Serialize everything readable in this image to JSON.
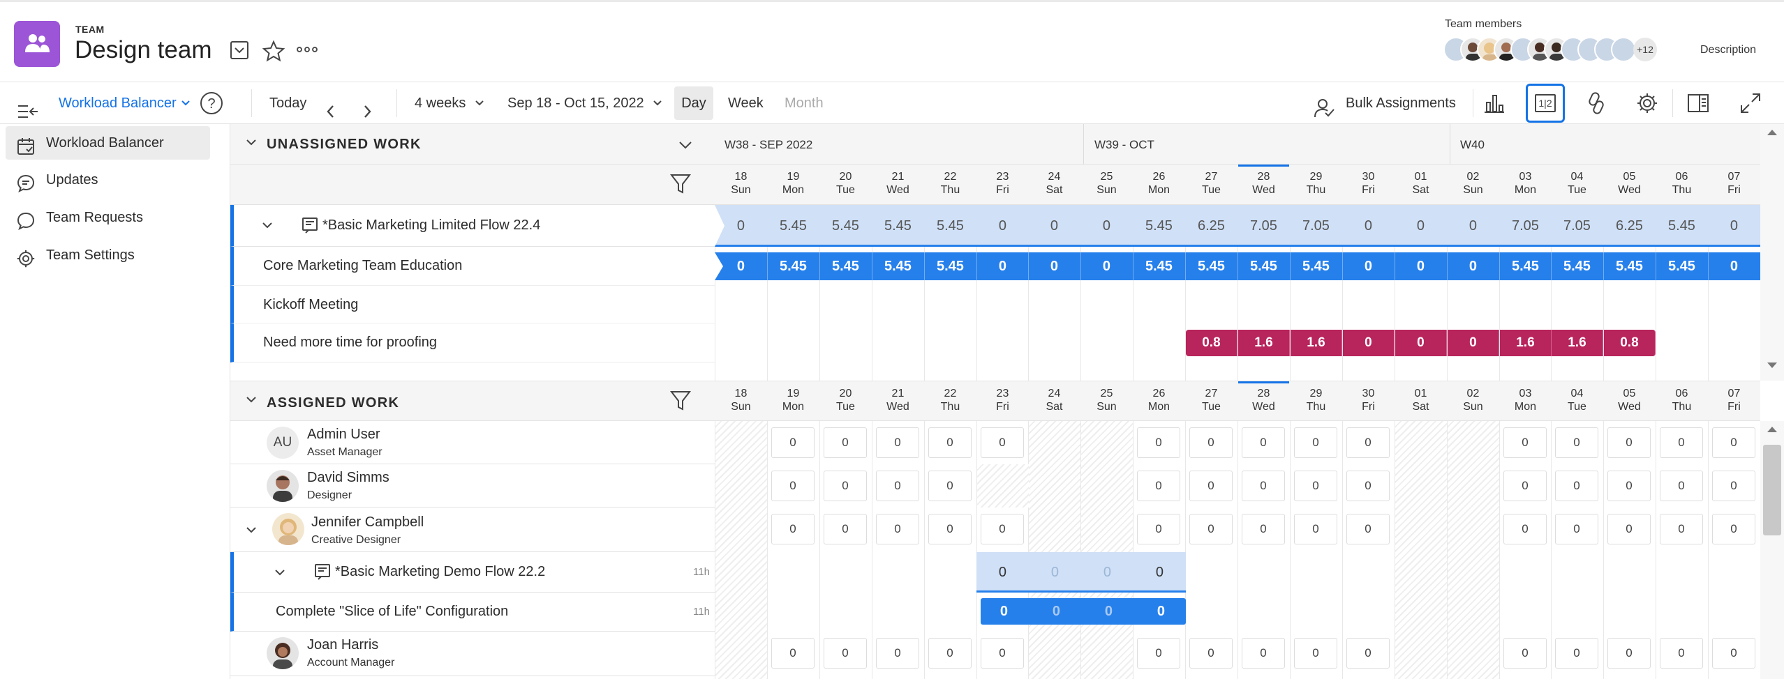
{
  "header": {
    "kicker": "TEAM",
    "title": "Design team",
    "members_label": "Team members",
    "members_more": "+12",
    "description_label": "Description"
  },
  "toolbar": {
    "view_name": "Workload Balancer",
    "today": "Today",
    "range_select": "4 weeks",
    "date_range": "Sep 18 - Oct 15, 2022",
    "day": "Day",
    "week": "Week",
    "month": "Month",
    "bulk_assignments": "Bulk Assignments",
    "toggle_label": "1|2"
  },
  "nav": [
    {
      "label": "Workload Balancer",
      "icon": "calendar-icon",
      "active": true
    },
    {
      "label": "Updates",
      "icon": "chat-bubble-icon",
      "active": false
    },
    {
      "label": "Team Requests",
      "icon": "chat-bubble-icon",
      "active": false
    },
    {
      "label": "Team Settings",
      "icon": "gear-icon",
      "active": false
    }
  ],
  "weeks": [
    {
      "label": "W38 - SEP 2022"
    },
    {
      "label": "W39 - OCT"
    },
    {
      "label": "W40"
    }
  ],
  "days": [
    {
      "d": "18",
      "w": "Sun",
      "weekend": true
    },
    {
      "d": "19",
      "w": "Mon"
    },
    {
      "d": "20",
      "w": "Tue"
    },
    {
      "d": "21",
      "w": "Wed"
    },
    {
      "d": "22",
      "w": "Thu"
    },
    {
      "d": "23",
      "w": "Fri"
    },
    {
      "d": "24",
      "w": "Sat",
      "weekend": true
    },
    {
      "d": "25",
      "w": "Sun",
      "weekend": true
    },
    {
      "d": "26",
      "w": "Mon"
    },
    {
      "d": "27",
      "w": "Tue"
    },
    {
      "d": "28",
      "w": "Wed",
      "today": true
    },
    {
      "d": "29",
      "w": "Thu"
    },
    {
      "d": "30",
      "w": "Fri"
    },
    {
      "d": "01",
      "w": "Sat",
      "weekend": true
    },
    {
      "d": "02",
      "w": "Sun",
      "weekend": true
    },
    {
      "d": "03",
      "w": "Mon"
    },
    {
      "d": "04",
      "w": "Tue"
    },
    {
      "d": "05",
      "w": "Wed"
    },
    {
      "d": "06",
      "w": "Thu"
    },
    {
      "d": "07",
      "w": "Fri"
    }
  ],
  "unassigned": {
    "title": "UNASSIGNED WORK",
    "project": {
      "name": "*Basic Marketing Limited Flow 22.4",
      "values": [
        "0",
        "5.45",
        "5.45",
        "5.45",
        "5.45",
        "0",
        "0",
        "0",
        "5.45",
        "6.25",
        "7.05",
        "7.05",
        "0",
        "0",
        "0",
        "7.05",
        "7.05",
        "6.25",
        "5.45",
        "0"
      ]
    },
    "tasks": [
      {
        "name": "Core Marketing Team Education",
        "values": [
          "0",
          "5.45",
          "5.45",
          "5.45",
          "5.45",
          "0",
          "0",
          "0",
          "5.45",
          "5.45",
          "5.45",
          "5.45",
          "0",
          "0",
          "0",
          "5.45",
          "5.45",
          "5.45",
          "5.45",
          "0"
        ]
      },
      {
        "name": "Kickoff Meeting"
      },
      {
        "name": "Need more time for proofing",
        "values": [
          "0.8",
          "1.6",
          "1.6",
          "0",
          "0",
          "0",
          "1.6",
          "1.6",
          "0.8"
        ]
      }
    ]
  },
  "assigned": {
    "title": "ASSIGNED WORK",
    "people": [
      {
        "name": "Admin User",
        "role": "Asset Manager",
        "initials": "AU"
      },
      {
        "name": "David Simms",
        "role": "Designer"
      },
      {
        "name": "Jennifer Campbell",
        "role": "Creative Designer"
      },
      {
        "name": "Joan Harris",
        "role": "Account Manager"
      }
    ],
    "cell_value": "0",
    "jen_project": {
      "name": "*Basic Marketing Demo Flow 22.2",
      "hours": "11h",
      "values": [
        "0",
        "0",
        "0",
        "0"
      ]
    },
    "jen_task": {
      "name": "Complete \"Slice of Life\" Configuration",
      "hours": "11h",
      "values": [
        "0",
        "0",
        "0",
        "0"
      ]
    }
  },
  "colors": {
    "accent": "#1473e6",
    "purple": "#9b55d6",
    "light_blue": "#cfe0f7",
    "bar_blue": "#2680eb",
    "pink": "#b8245c"
  }
}
